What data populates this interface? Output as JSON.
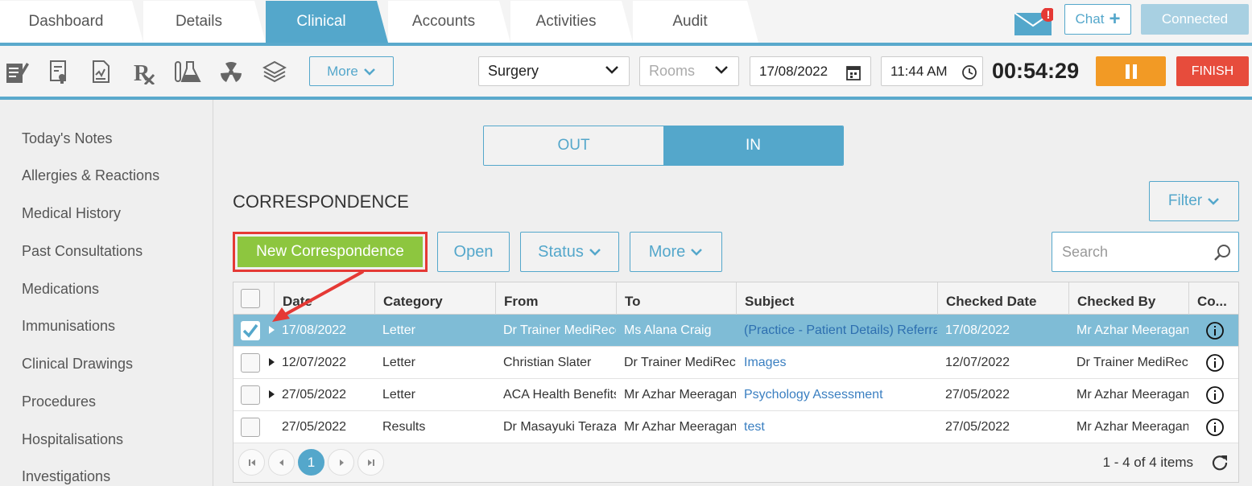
{
  "tabs": [
    "Dashboard",
    "Details",
    "Clinical",
    "Accounts",
    "Activities",
    "Audit"
  ],
  "active_tab": "Clinical",
  "header": {
    "chat_label": "Chat",
    "connected_label": "Connected",
    "notification_badge": "!"
  },
  "toolbar": {
    "more_label": "More",
    "location_value": "Surgery",
    "rooms_placeholder": "Rooms",
    "date_value": "17/08/2022",
    "time_value": "11:44 AM",
    "timer": "00:54:29",
    "finish_label": "FINISH"
  },
  "sidebar": {
    "items": [
      "Today's Notes",
      "Allergies & Reactions",
      "Medical History",
      "Past Consultations",
      "Medications",
      "Immunisations",
      "Clinical Drawings",
      "Procedures",
      "Hospitalisations",
      "Investigations"
    ]
  },
  "toggle": {
    "out_label": "OUT",
    "in_label": "IN",
    "active": "IN"
  },
  "section": {
    "title": "CORRESPONDENCE",
    "filter_label": "Filter",
    "new_label": "New Correspondence",
    "open_label": "Open",
    "status_label": "Status",
    "more_label": "More",
    "search_placeholder": "Search"
  },
  "table": {
    "headers": [
      "Date",
      "Category",
      "From",
      "To",
      "Subject",
      "Checked Date",
      "Checked By",
      "Co..."
    ],
    "rows": [
      {
        "date": "17/08/2022",
        "category": "Letter",
        "from": "Dr Trainer MediRecords",
        "to": "Ms Alana Craig",
        "subject": "(Practice - Patient Details) Referral",
        "checked_date": "17/08/2022",
        "checked_by": "Mr Azhar Meeragani",
        "selected": true,
        "expandable": true
      },
      {
        "date": "12/07/2022",
        "category": "Letter",
        "from": "Christian Slater",
        "to": "Dr Trainer MediRecords",
        "subject": "Images",
        "checked_date": "12/07/2022",
        "checked_by": "Dr Trainer MediRecords",
        "selected": false,
        "expandable": true
      },
      {
        "date": "27/05/2022",
        "category": "Letter",
        "from": "ACA Health Benefits",
        "to": "Mr Azhar Meeragani",
        "subject": "Psychology Assessment",
        "checked_date": "27/05/2022",
        "checked_by": "Mr Azhar Meeragani",
        "selected": false,
        "expandable": true
      },
      {
        "date": "27/05/2022",
        "category": "Results",
        "from": "Dr Masayuki Terazawa",
        "to": "Mr Azhar Meeragani",
        "subject": "test",
        "checked_date": "27/05/2022",
        "checked_by": "Mr Azhar Meeragani",
        "selected": false,
        "expandable": false
      }
    ]
  },
  "pager": {
    "current_page": "1",
    "summary": "1 - 4 of 4 items"
  },
  "colors": {
    "accent": "#54a7cb",
    "new_button": "#8dc63f",
    "pause": "#f29a25",
    "finish": "#e74c3c",
    "highlight_box": "#e53935"
  }
}
